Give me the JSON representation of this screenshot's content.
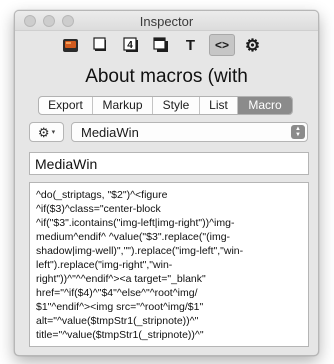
{
  "window": {
    "title": "Inspector"
  },
  "toolbar": {
    "tools": [
      {
        "name": "header-icon",
        "glyph": ""
      },
      {
        "name": "document-icon",
        "glyph": ""
      },
      {
        "name": "number-icon",
        "glyph": "4"
      },
      {
        "name": "layers-icon",
        "glyph": ""
      },
      {
        "name": "text-icon",
        "glyph": "T"
      },
      {
        "name": "code-icon",
        "glyph": "<>"
      },
      {
        "name": "gear-icon",
        "glyph": "⚙"
      }
    ],
    "selected": "code-icon"
  },
  "heading": "About macros (with",
  "tabs": [
    "Export",
    "Markup",
    "Style",
    "List",
    "Macro"
  ],
  "active_tab": "Macro",
  "gear_button": {
    "glyph": "⚙",
    "caret": "▾"
  },
  "macro_popup": {
    "value": "MediaWin",
    "arrows_up": "▲",
    "arrows_down": "▼"
  },
  "name_field": {
    "value": "MediaWin"
  },
  "code": {
    "lines": [
      "^do(_striptags, \"$2\")^<figure",
      "^if($3)^class=\"center-block",
      "^if(\"$3\".icontains(\"img-left|img-right\"))^img-",
      "medium^endif^ ^value(\"$3\".replace(\"(img-",
      "shadow|img-well)\",\"\").replace(\"img-left\",\"win-",
      "left\").replace(\"img-right\",\"win-",
      "right\"))^\"^^endif^><a target=\"_blank\"",
      "href=\"^if($4)^\"$4\"^else^\"^root^img/",
      "$1\"^endif^><img src=\"^root^img/$1\"",
      "alt=\"^value($tmpStr1(_stripnote))^\"",
      "title=\"^value($tmpStr1(_stripnote))^\""
    ]
  },
  "colors": {
    "active_tab_bg": "#8b8b8b",
    "window_bg": "#e6e6e6"
  }
}
